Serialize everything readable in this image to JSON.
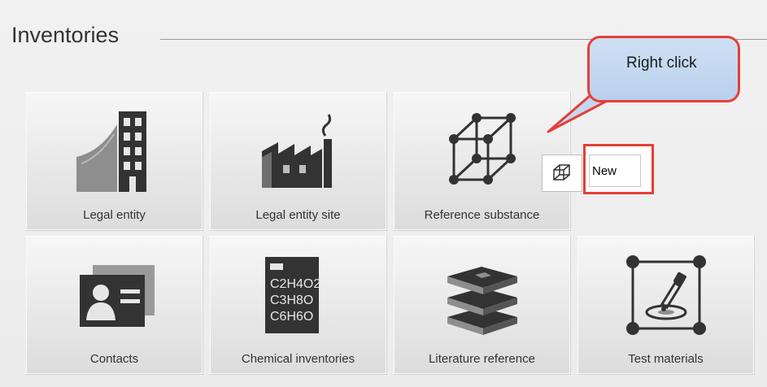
{
  "header": {
    "title": "Inventories"
  },
  "tiles": [
    {
      "label": "Legal entity",
      "icon": "building-icon"
    },
    {
      "label": "Legal entity site",
      "icon": "factory-icon"
    },
    {
      "label": "Reference substance",
      "icon": "molecule-lattice-icon"
    },
    {
      "label": "Contacts",
      "icon": "contact-card-icon"
    },
    {
      "label": "Chemical inventories",
      "icon": "chemical-formula-icon"
    },
    {
      "label": "Literature reference",
      "icon": "books-stack-icon"
    },
    {
      "label": "Test materials",
      "icon": "test-material-icon"
    }
  ],
  "formula_lines": [
    "C2H4O2",
    "C3H8O",
    "C6H6O"
  ],
  "context_menu": {
    "new_label": "New",
    "icon": "molecule-lattice-small-icon"
  },
  "callout": {
    "text": "Right click"
  },
  "colors": {
    "accent_red": "#e53f38",
    "callout_fill": "#c4d8f0",
    "icon_dark": "#333333",
    "tile_bg": "#e6e6e6"
  }
}
